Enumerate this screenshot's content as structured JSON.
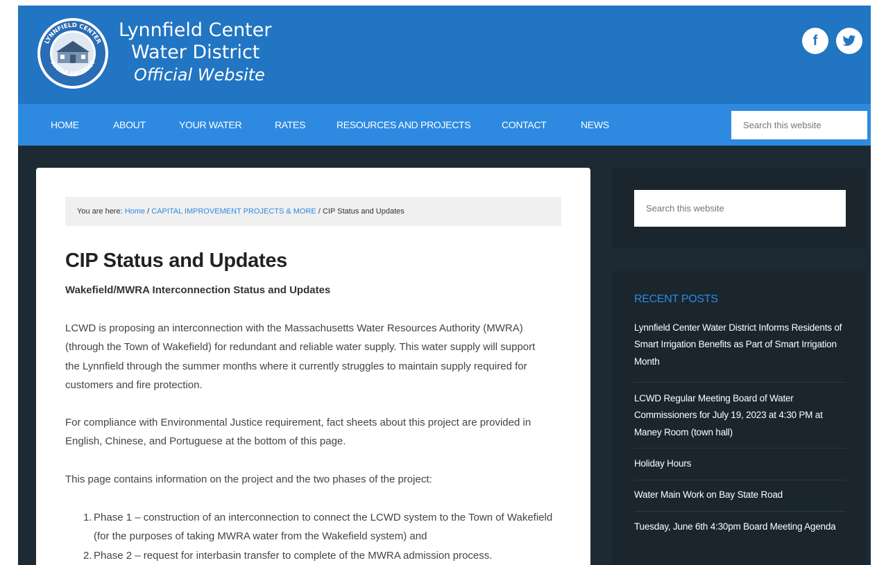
{
  "header": {
    "logo_text": "LYNNFIELD CENTER WATER DISTRICT",
    "title_line1": "Lynnfield Center",
    "title_line2": "Water District",
    "title_line3": "Official Website",
    "social": [
      {
        "icon": "facebook-icon",
        "glyph": "f"
      },
      {
        "icon": "twitter-icon",
        "glyph": "🐦"
      }
    ]
  },
  "nav": {
    "items": [
      {
        "label": "Home"
      },
      {
        "label": "About"
      },
      {
        "label": "Your Water"
      },
      {
        "label": "Rates"
      },
      {
        "label": "Resources and Projects"
      },
      {
        "label": "Contact"
      },
      {
        "label": "News"
      }
    ],
    "search_placeholder": "Search this website"
  },
  "breadcrumb": {
    "prefix": "You are here: ",
    "home": "Home",
    "sep": " / ",
    "parent": "CAPITAL IMPROVEMENT PROJECTS & MORE",
    "current": "CIP Status and Updates"
  },
  "entry": {
    "title": "CIP Status and Updates",
    "subheading": "Wakefield/MWRA Interconnection Status and Updates",
    "p1": "LCWD is proposing an interconnection with the Massachusetts Water Resources Authority (MWRA) (through the Town of Wakefield) for redundant and reliable water supply. This water supply will support the Lynnfield through the summer months where it currently struggles to maintain supply required for customers and fire protection.",
    "p2": "For compliance with Environmental Justice requirement, fact sheets about this project are provided in English, Chinese, and Portuguese at the bottom of this page.",
    "p3": "This page contains information on the project and the two phases of the project:",
    "list": [
      {
        "num": "1.",
        "text": "Phase 1 – construction of an interconnection to connect the LCWD system to the Town of Wakefield (for the purposes of taking MWRA water from the Wakefield system) and"
      },
      {
        "num": "2.",
        "text": "Phase 2 – request for interbasin transfer to complete of the MWRA admission process."
      }
    ]
  },
  "sidebar": {
    "search_placeholder": "Search this website",
    "recent_title": "Recent Posts",
    "posts": [
      {
        "title": "Lynnfield Center Water District Informs Residents of Smart Irrigation Benefits as Part of Smart Irrigation Month"
      },
      {
        "title": "LCWD Regular Meeting Board of Water Commissioners for July 19, 2023 at 4:30 PM at Maney Room (town hall)"
      },
      {
        "title": "Holiday Hours"
      },
      {
        "title": "Water Main Work on Bay State Road"
      },
      {
        "title": "Tuesday, June 6th 4:30pm Board Meeting Agenda"
      }
    ]
  },
  "colors": {
    "header_blue": "#2175c2",
    "nav_blue": "#2e8ae0",
    "page_dark": "#1e2a33",
    "link_blue": "#2e8ae0"
  }
}
